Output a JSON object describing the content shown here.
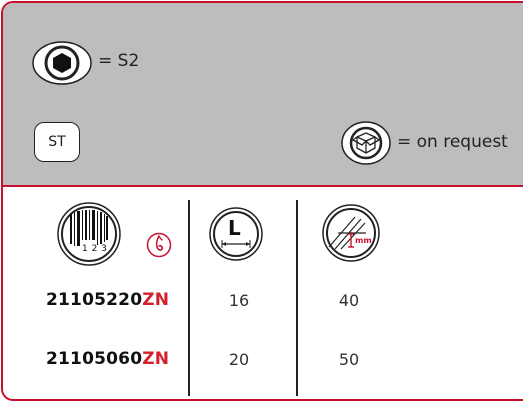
{
  "header": {
    "drive_text": "= S2",
    "st_label": "ST",
    "request_text": "= on request"
  },
  "table": {
    "rows": [
      {
        "code_prefix": "21105220",
        "code_suffix": "ZN",
        "length": "16",
        "box_qty": "40"
      },
      {
        "code_prefix": "21105060",
        "code_suffix": "ZN",
        "length": "20",
        "box_qty": "50"
      }
    ]
  },
  "icons": {
    "barcode_digits": "1 2 3",
    "length_letter": "L",
    "measure_unit": "mm"
  },
  "colors": {
    "accent": "#c8102e",
    "suffix": "#d4202c",
    "header_bg": "#bdbdbd"
  }
}
